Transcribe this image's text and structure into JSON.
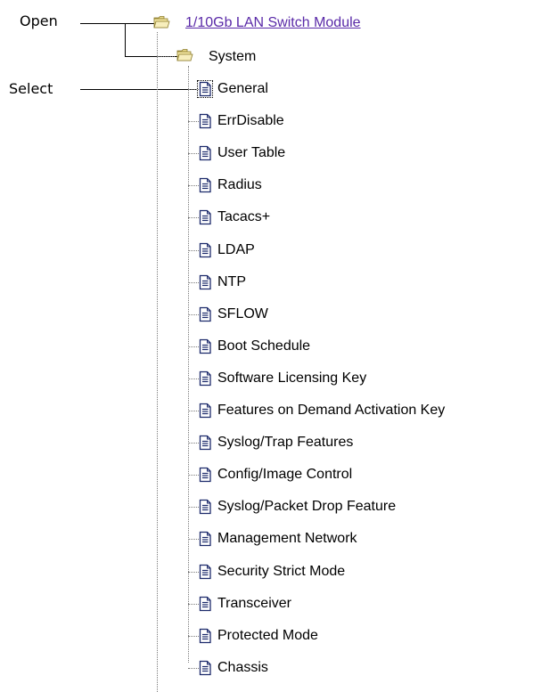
{
  "callouts": {
    "open": "Open",
    "select": "Select"
  },
  "tree": {
    "root": {
      "label": "1/10Gb LAN Switch Module",
      "icon": "folder-open-icon"
    },
    "system": {
      "label": "System",
      "icon": "folder-open-icon"
    },
    "items": [
      {
        "label": "General",
        "icon": "document-icon",
        "selected": true
      },
      {
        "label": "ErrDisable",
        "icon": "document-icon"
      },
      {
        "label": "User Table",
        "icon": "document-icon"
      },
      {
        "label": "Radius",
        "icon": "document-icon"
      },
      {
        "label": "Tacacs+",
        "icon": "document-icon"
      },
      {
        "label": "LDAP",
        "icon": "document-icon"
      },
      {
        "label": "NTP",
        "icon": "document-icon"
      },
      {
        "label": "SFLOW",
        "icon": "document-icon"
      },
      {
        "label": "Boot Schedule",
        "icon": "document-icon"
      },
      {
        "label": "Software Licensing Key",
        "icon": "document-icon"
      },
      {
        "label": "Features on Demand Activation Key",
        "icon": "document-icon"
      },
      {
        "label": "Syslog/Trap Features",
        "icon": "document-icon"
      },
      {
        "label": "Config/Image Control",
        "icon": "document-icon"
      },
      {
        "label": "Syslog/Packet Drop Feature",
        "icon": "document-icon"
      },
      {
        "label": "Management Network",
        "icon": "document-icon"
      },
      {
        "label": "Security Strict Mode",
        "icon": "document-icon"
      },
      {
        "label": "Transceiver",
        "icon": "document-icon"
      },
      {
        "label": "Protected Mode",
        "icon": "document-icon"
      },
      {
        "label": "Chassis",
        "icon": "document-icon"
      }
    ]
  }
}
